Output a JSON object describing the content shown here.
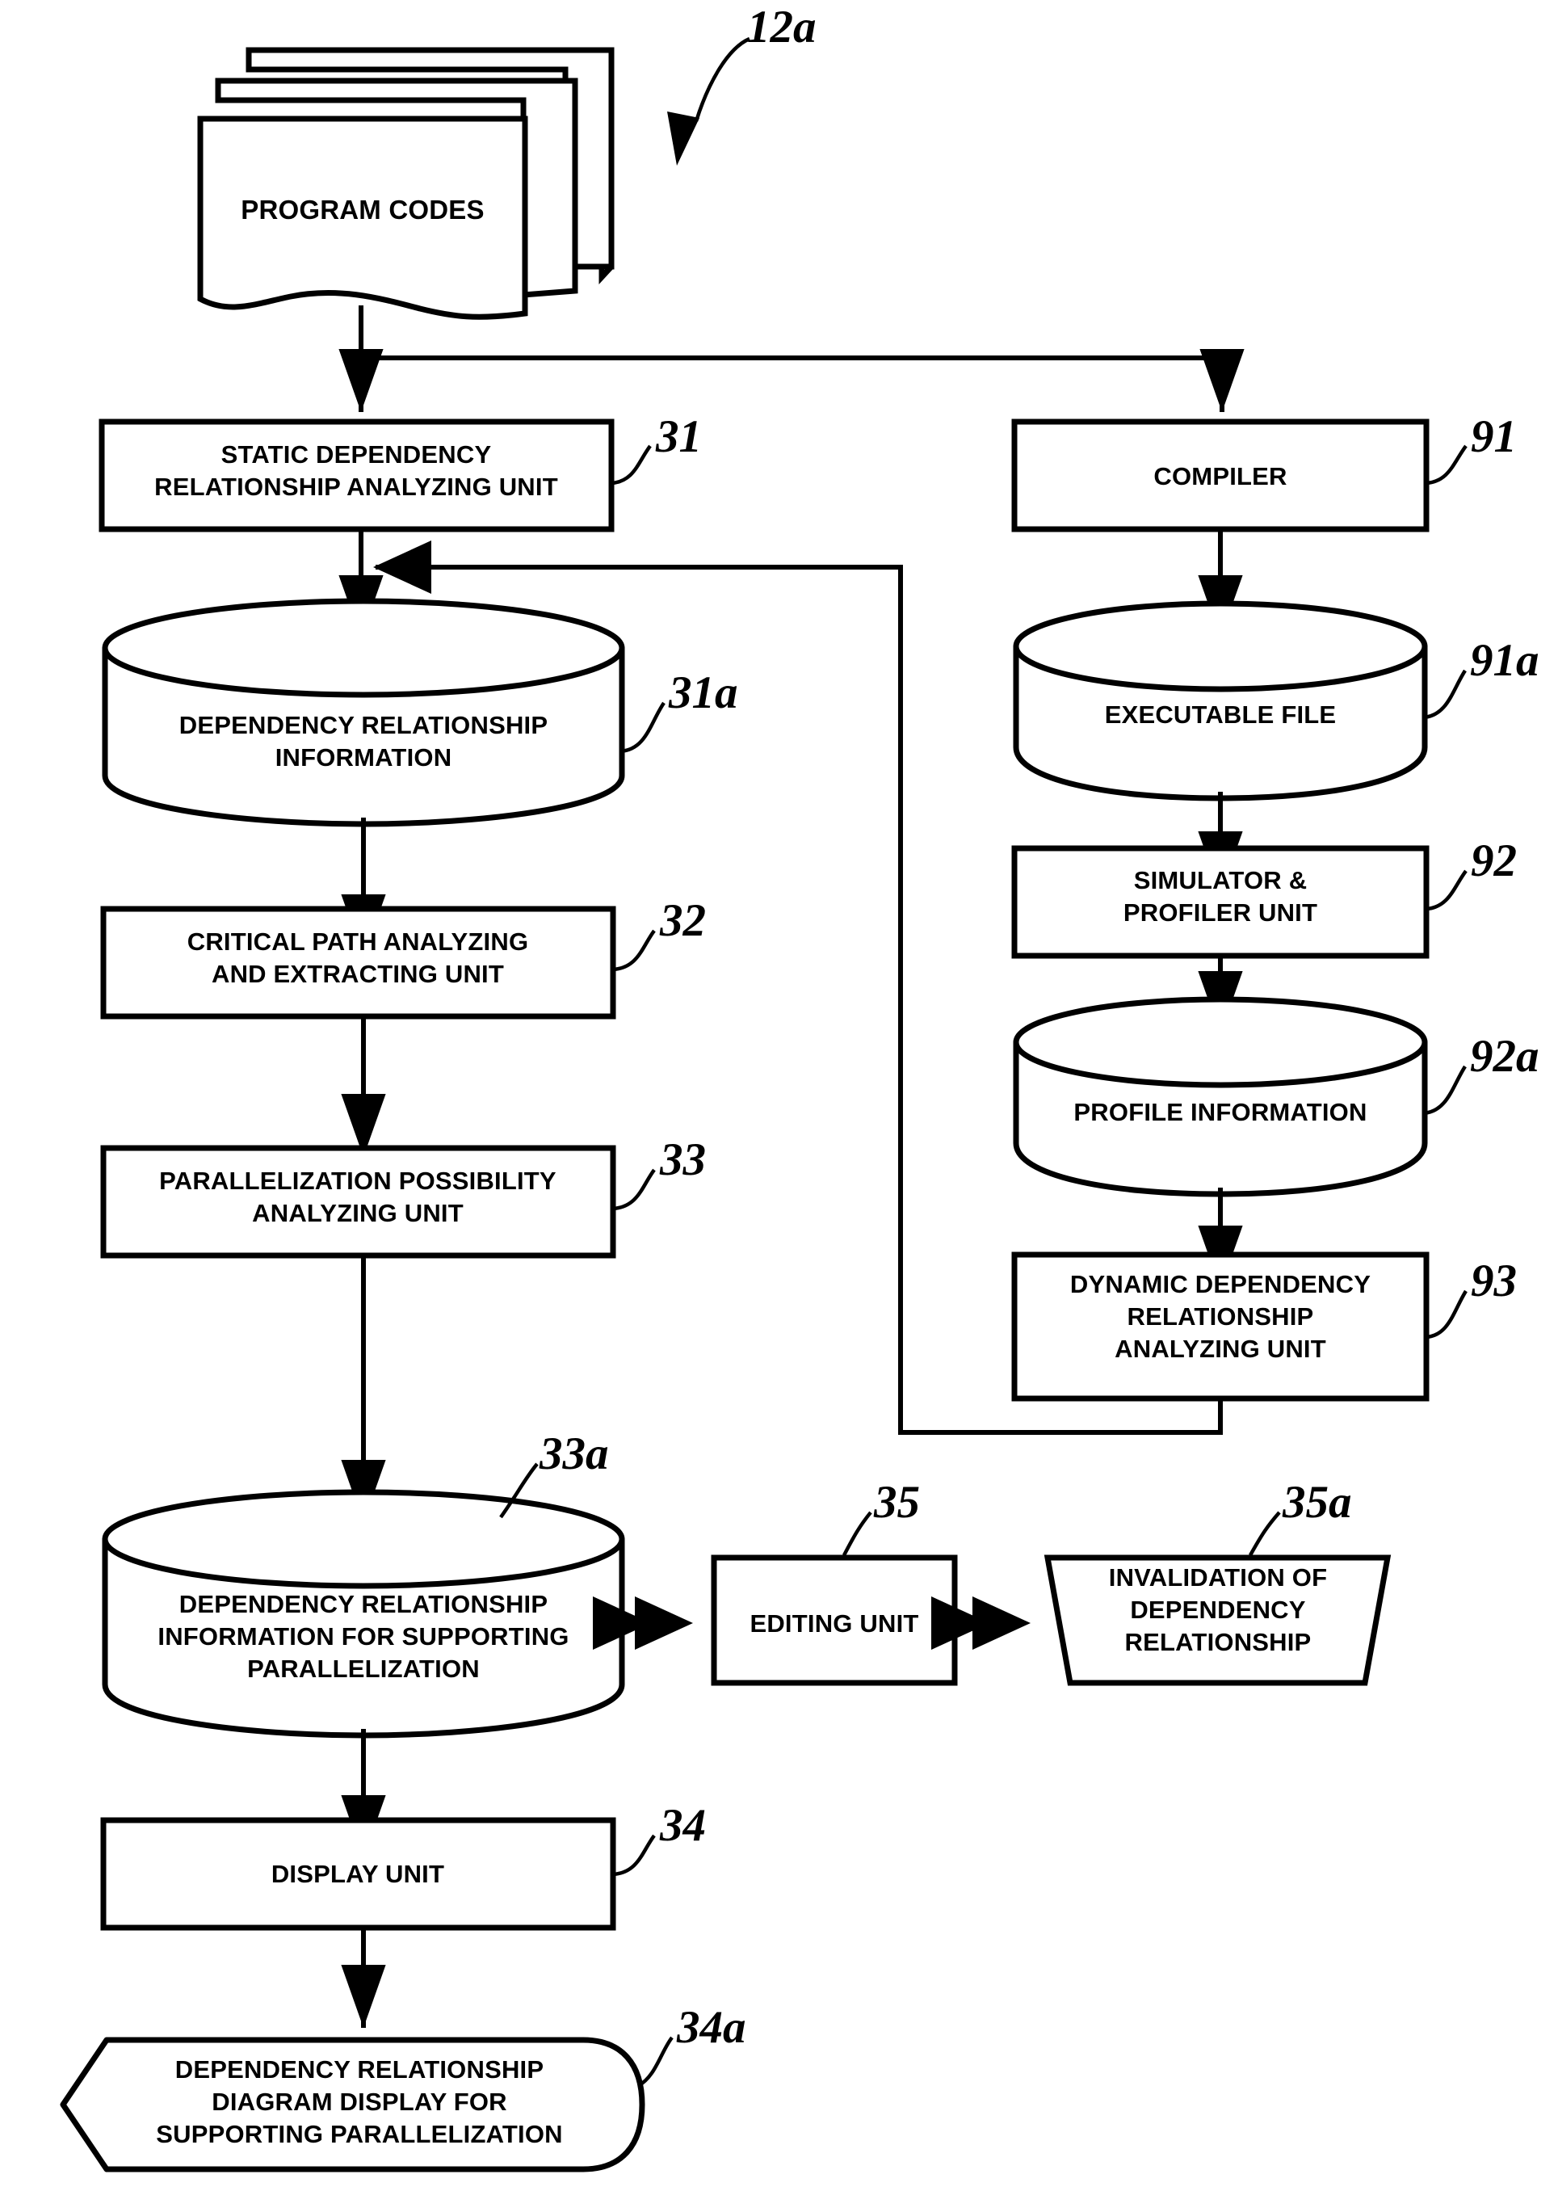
{
  "figure": {
    "title_ref": "12a",
    "background_color": "#ffffff",
    "line_color": "#000000"
  },
  "nodes": {
    "program_codes": {
      "label": "PROGRAM CODES",
      "shape": "stacked-document",
      "ref": "12a"
    },
    "static_dep_unit": {
      "label_line1": "STATIC DEPENDENCY",
      "label_line2": "RELATIONSHIP ANALYZING UNIT",
      "shape": "rectangle",
      "ref": "31"
    },
    "dep_info": {
      "label_line1": "DEPENDENCY RELATIONSHIP",
      "label_line2": "INFORMATION",
      "shape": "cylinder",
      "ref": "31a"
    },
    "critical_path_unit": {
      "label_line1": "CRITICAL PATH ANALYZING",
      "label_line2": "AND EXTRACTING UNIT",
      "shape": "rectangle",
      "ref": "32"
    },
    "parallelization_unit": {
      "label_line1": "PARALLELIZATION POSSIBILITY",
      "label_line2": "ANALYZING UNIT",
      "shape": "rectangle",
      "ref": "33"
    },
    "dep_info_support": {
      "label_line1": "DEPENDENCY RELATIONSHIP",
      "label_line2": "INFORMATION FOR SUPPORTING",
      "label_line3": "PARALLELIZATION",
      "shape": "cylinder",
      "ref": "33a"
    },
    "display_unit": {
      "label": "DISPLAY UNIT",
      "shape": "rectangle",
      "ref": "34"
    },
    "dep_diagram_display": {
      "label_line1": "DEPENDENCY RELATIONSHIP",
      "label_line2": "DIAGRAM DISPLAY FOR",
      "label_line3": "SUPPORTING PARALLELIZATION",
      "shape": "display-output",
      "ref": "34a"
    },
    "editing_unit": {
      "label": "EDITING UNIT",
      "shape": "rectangle",
      "ref": "35"
    },
    "invalidation": {
      "label_line1": "INVALIDATION OF",
      "label_line2": "DEPENDENCY",
      "label_line3": "RELATIONSHIP",
      "shape": "trapezoid",
      "ref": "35a"
    },
    "compiler": {
      "label": "COMPILER",
      "shape": "rectangle",
      "ref": "91"
    },
    "executable_file": {
      "label": "EXECUTABLE FILE",
      "shape": "cylinder",
      "ref": "91a"
    },
    "simulator_profiler": {
      "label_line1": "SIMULATOR &",
      "label_line2": "PROFILER UNIT",
      "shape": "rectangle",
      "ref": "92"
    },
    "profile_info": {
      "label": "PROFILE INFORMATION",
      "shape": "cylinder",
      "ref": "92a"
    },
    "dynamic_dep_unit": {
      "label_line1": "DYNAMIC DEPENDENCY",
      "label_line2": "RELATIONSHIP",
      "label_line3": "ANALYZING UNIT",
      "shape": "rectangle",
      "ref": "93"
    }
  },
  "refs": {
    "r12a": "12a",
    "r31": "31",
    "r31a": "31a",
    "r32": "32",
    "r33": "33",
    "r33a": "33a",
    "r34": "34",
    "r34a": "34a",
    "r35": "35",
    "r35a": "35a",
    "r91": "91",
    "r91a": "91a",
    "r92": "92",
    "r92a": "92a",
    "r93": "93"
  }
}
